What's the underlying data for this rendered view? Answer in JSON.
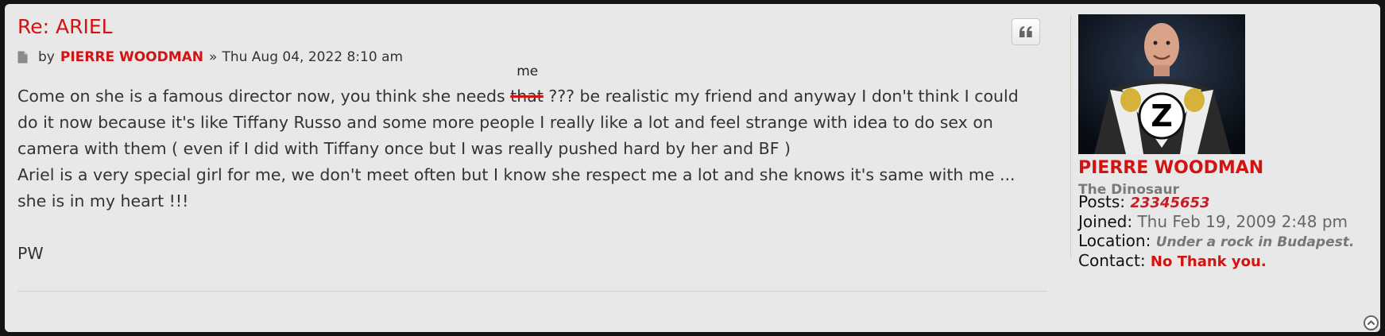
{
  "post": {
    "title": "Re: ARIEL",
    "by_label": "by",
    "author": "PIERRE WOODMAN",
    "separator": "»",
    "date": "Thu Aug 04, 2022 8:10 am",
    "content": {
      "line1_before": "Come on she is a famous director now, you think she needs ",
      "struck_word": "that",
      "inserted_word": "me",
      "line1_after": " ??? be realistic my friend and anyway I don't think I could",
      "line2": "do it now because it's like Tiffany Russo and some more people I really like a lot and feel strange with idea to do sex on",
      "line3": "camera with them ( even if I did with Tiffany once but I was really pushed hard by her and BF )",
      "line4": "Ariel is a very special girl for me, we don't meet often but I know she respect me a lot and she knows it's same with me ...",
      "line5": "she is in my heart !!!",
      "signature": "PW"
    },
    "quote_icon": "quote-icon",
    "post_icon": "document-icon"
  },
  "profile": {
    "username": "PIERRE WOODMAN",
    "rank": "The Dinosaur",
    "avatar_letter": "Z",
    "posts_label": "Posts:",
    "posts_value": "23345653",
    "joined_label": "Joined:",
    "joined_value": "Thu Feb 19, 2009 2:48 pm",
    "location_label": "Location:",
    "location_value": "Under a rock in Budapest.",
    "contact_label": "Contact:",
    "contact_value": "No Thank you."
  },
  "colors": {
    "accent": "#d31212",
    "panel": "#e8e8e8",
    "frame": "#141414"
  },
  "back_to_top_icon": "chevron-up-icon"
}
